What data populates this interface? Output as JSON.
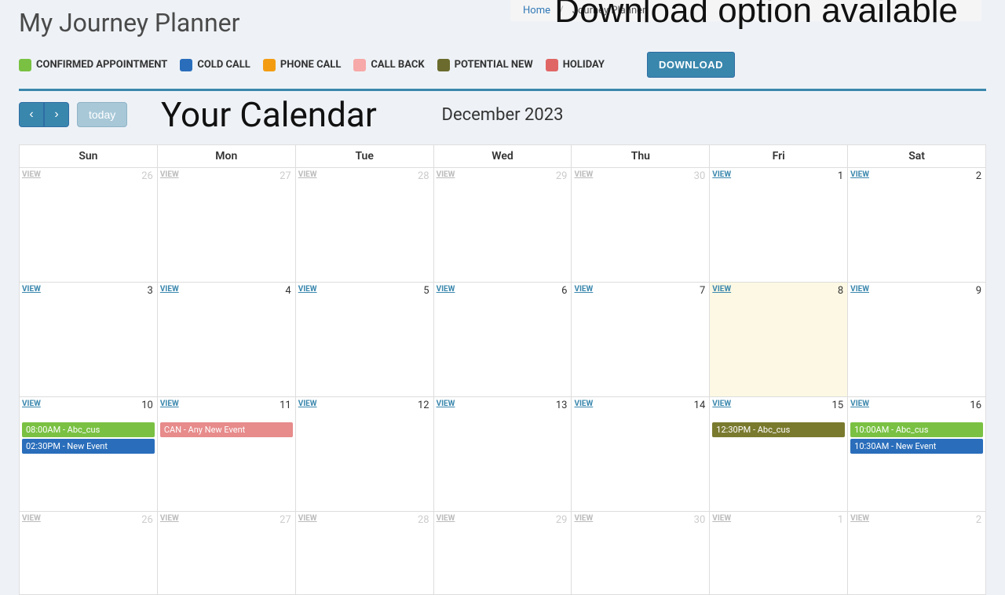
{
  "breadcrumb": {
    "home": "Home",
    "current": "Journey Planner"
  },
  "page_title": "My Journey Planner",
  "legend": [
    {
      "label": "CONFIRMED APPOINTMENT",
      "color": "#7ac143"
    },
    {
      "label": "COLD CALL",
      "color": "#2a6ebb"
    },
    {
      "label": "PHONE CALL",
      "color": "#f39c12"
    },
    {
      "label": "CALL BACK",
      "color": "#f7a8a8"
    },
    {
      "label": "POTENTIAL NEW",
      "color": "#6b6b2d"
    },
    {
      "label": "HOLIDAY",
      "color": "#e06666"
    }
  ],
  "download_button": "DOWNLOAD",
  "overlay": {
    "download": "Download option available",
    "calendar": "Your Calendar"
  },
  "toolbar": {
    "prev": "‹",
    "next": "›",
    "today": "today",
    "month": "December 2023"
  },
  "day_headers": [
    "Sun",
    "Mon",
    "Tue",
    "Wed",
    "Thu",
    "Fri",
    "Sat"
  ],
  "view_label": "VIEW",
  "colors": {
    "confirmed": "#7ac143",
    "cold_call": "#2a6ebb",
    "call_back": "#e78b8b",
    "potential": "#7a7a2f"
  },
  "weeks": [
    {
      "days": [
        {
          "num": "26",
          "other": true
        },
        {
          "num": "27",
          "other": true
        },
        {
          "num": "28",
          "other": true
        },
        {
          "num": "29",
          "other": true
        },
        {
          "num": "30",
          "other": true
        },
        {
          "num": "1"
        },
        {
          "num": "2"
        }
      ]
    },
    {
      "days": [
        {
          "num": "3"
        },
        {
          "num": "4"
        },
        {
          "num": "5"
        },
        {
          "num": "6"
        },
        {
          "num": "7"
        },
        {
          "num": "8",
          "highlight": true
        },
        {
          "num": "9"
        }
      ]
    },
    {
      "days": [
        {
          "num": "10",
          "events": [
            {
              "text": "08:00AM - Abc_cus",
              "colorKey": "confirmed"
            },
            {
              "text": "02:30PM - New Event",
              "colorKey": "cold_call"
            }
          ]
        },
        {
          "num": "11",
          "events": [
            {
              "text": "CAN - Any New Event",
              "colorKey": "call_back"
            }
          ]
        },
        {
          "num": "12"
        },
        {
          "num": "13"
        },
        {
          "num": "14"
        },
        {
          "num": "15",
          "events": [
            {
              "text": "12:30PM - Abc_cus",
              "colorKey": "potential"
            }
          ]
        },
        {
          "num": "16",
          "events": [
            {
              "text": "10:00AM - Abc_cus",
              "colorKey": "confirmed"
            },
            {
              "text": "10:30AM - New Event",
              "colorKey": "cold_call"
            }
          ]
        }
      ]
    },
    {
      "short": true,
      "days": [
        {
          "num": "26",
          "other": true
        },
        {
          "num": "27",
          "other": true
        },
        {
          "num": "28",
          "other": true
        },
        {
          "num": "29",
          "other": true
        },
        {
          "num": "30",
          "other": true
        },
        {
          "num": "1",
          "other": true
        },
        {
          "num": "2",
          "other": true
        }
      ]
    }
  ]
}
